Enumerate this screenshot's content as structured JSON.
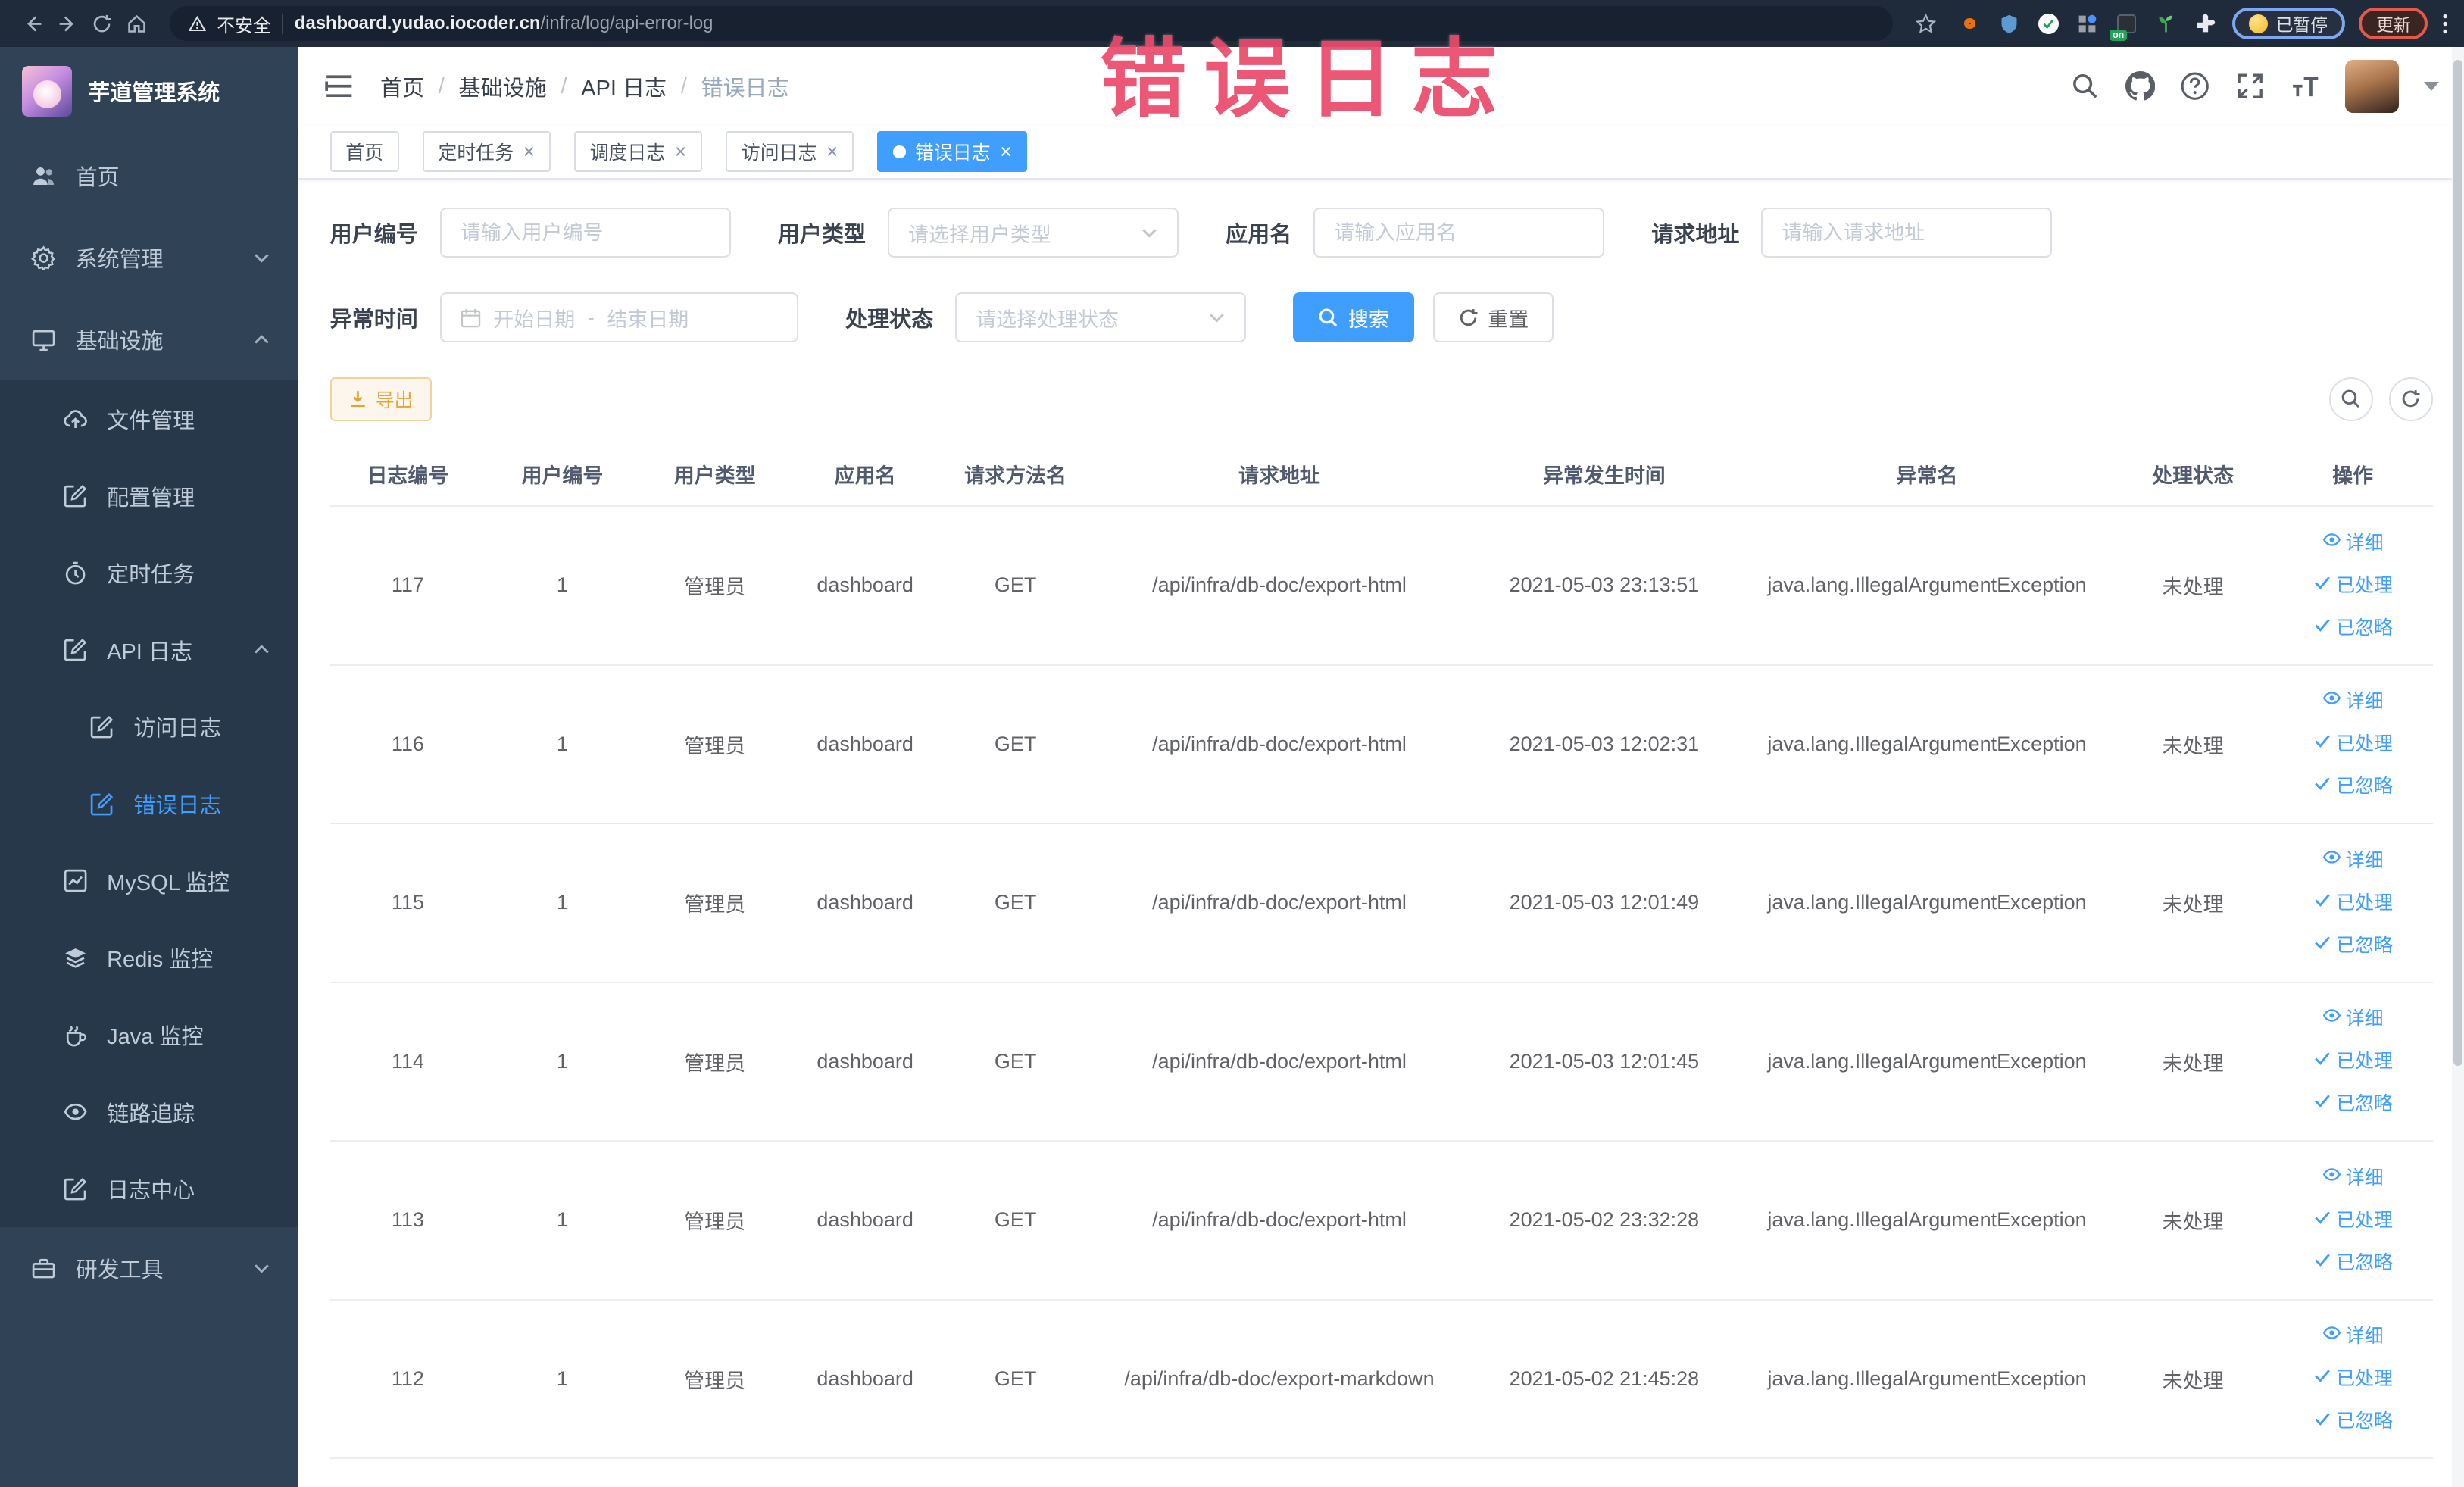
{
  "annotation": {
    "text": "错误日志"
  },
  "browser": {
    "security_label": "不安全",
    "url_host": "dashboard.yudao.iocoder.cn",
    "url_path": "/infra/log/api-error-log",
    "paused_label": "已暂停",
    "update_label": "更新"
  },
  "sidebar": {
    "app_title": "芋道管理系统",
    "items": [
      {
        "label": "首页",
        "icon": "people",
        "level": 1,
        "active": false,
        "chevron": null
      },
      {
        "label": "系统管理",
        "icon": "gear",
        "level": 1,
        "active": false,
        "chevron": "down"
      },
      {
        "label": "基础设施",
        "icon": "monitor",
        "level": 1,
        "active": false,
        "chevron": "up"
      },
      {
        "label": "文件管理",
        "icon": "cloud-upload",
        "level": 2,
        "active": false,
        "chevron": null
      },
      {
        "label": "配置管理",
        "icon": "edit",
        "level": 2,
        "active": false,
        "chevron": null
      },
      {
        "label": "定时任务",
        "icon": "timer",
        "level": 2,
        "active": false,
        "chevron": null
      },
      {
        "label": "API 日志",
        "icon": "log",
        "level": 2,
        "active": false,
        "chevron": "up"
      },
      {
        "label": "访问日志",
        "icon": "log",
        "level": 3,
        "active": false,
        "chevron": null
      },
      {
        "label": "错误日志",
        "icon": "log",
        "level": 3,
        "active": true,
        "chevron": null
      },
      {
        "label": "MySQL 监控",
        "icon": "chart",
        "level": 2,
        "active": false,
        "chevron": null
      },
      {
        "label": "Redis 监控",
        "icon": "layers",
        "level": 2,
        "active": false,
        "chevron": null
      },
      {
        "label": "Java 监控",
        "icon": "java",
        "level": 2,
        "active": false,
        "chevron": null
      },
      {
        "label": "链路追踪",
        "icon": "eye",
        "level": 2,
        "active": false,
        "chevron": null
      },
      {
        "label": "日志中心",
        "icon": "log",
        "level": 2,
        "active": false,
        "chevron": null
      },
      {
        "label": "研发工具",
        "icon": "toolbox",
        "level": 1,
        "active": false,
        "chevron": "down"
      }
    ]
  },
  "navbar": {
    "breadcrumb": [
      "首页",
      "基础设施",
      "API 日志",
      "错误日志"
    ]
  },
  "tabs": [
    {
      "label": "首页",
      "closable": false,
      "active": false
    },
    {
      "label": "定时任务",
      "closable": true,
      "active": false
    },
    {
      "label": "调度日志",
      "closable": true,
      "active": false
    },
    {
      "label": "访问日志",
      "closable": true,
      "active": false
    },
    {
      "label": "错误日志",
      "closable": true,
      "active": true
    }
  ],
  "filters": {
    "user_id_label": "用户编号",
    "user_id_placeholder": "请输入用户编号",
    "user_type_label": "用户类型",
    "user_type_placeholder": "请选择用户类型",
    "app_name_label": "应用名",
    "app_name_placeholder": "请输入应用名",
    "request_url_label": "请求地址",
    "request_url_placeholder": "请输入请求地址",
    "exception_time_label": "异常时间",
    "start_date_placeholder": "开始日期",
    "range_separator": "-",
    "end_date_placeholder": "结束日期",
    "process_status_label": "处理状态",
    "process_status_placeholder": "请选择处理状态",
    "search_label": "搜索",
    "reset_label": "重置"
  },
  "toolbar": {
    "export_label": "导出"
  },
  "table": {
    "columns": [
      "日志编号",
      "用户编号",
      "用户类型",
      "应用名",
      "请求方法名",
      "请求地址",
      "异常发生时间",
      "异常名",
      "处理状态",
      "操作"
    ],
    "actions": [
      "详细",
      "已处理",
      "已忽略"
    ],
    "rows": [
      {
        "id": "117",
        "user_id": "1",
        "user_type": "管理员",
        "app": "dashboard",
        "method": "GET",
        "url": "/api/infra/db-doc/export-html",
        "time": "2021-05-03 23:13:51",
        "exception": "java.lang.IllegalArgumentException",
        "status": "未处理"
      },
      {
        "id": "116",
        "user_id": "1",
        "user_type": "管理员",
        "app": "dashboard",
        "method": "GET",
        "url": "/api/infra/db-doc/export-html",
        "time": "2021-05-03 12:02:31",
        "exception": "java.lang.IllegalArgumentException",
        "status": "未处理"
      },
      {
        "id": "115",
        "user_id": "1",
        "user_type": "管理员",
        "app": "dashboard",
        "method": "GET",
        "url": "/api/infra/db-doc/export-html",
        "time": "2021-05-03 12:01:49",
        "exception": "java.lang.IllegalArgumentException",
        "status": "未处理"
      },
      {
        "id": "114",
        "user_id": "1",
        "user_type": "管理员",
        "app": "dashboard",
        "method": "GET",
        "url": "/api/infra/db-doc/export-html",
        "time": "2021-05-03 12:01:45",
        "exception": "java.lang.IllegalArgumentException",
        "status": "未处理"
      },
      {
        "id": "113",
        "user_id": "1",
        "user_type": "管理员",
        "app": "dashboard",
        "method": "GET",
        "url": "/api/infra/db-doc/export-html",
        "time": "2021-05-02 23:32:28",
        "exception": "java.lang.IllegalArgumentException",
        "status": "未处理"
      },
      {
        "id": "112",
        "user_id": "1",
        "user_type": "管理员",
        "app": "dashboard",
        "method": "GET",
        "url": "/api/infra/db-doc/export-markdown",
        "time": "2021-05-02 21:45:28",
        "exception": "java.lang.IllegalArgumentException",
        "status": "未处理"
      }
    ]
  },
  "colors": {
    "primary": "#409eff",
    "warning": "#e6a23c",
    "annotation": "#ec4b6c",
    "browser_bar_bg": "#1f2a3a",
    "sidebar_bg": "#2f4256",
    "sidebar_sub_bg": "#26384a",
    "sidebar_text": "#bfcbd9"
  }
}
